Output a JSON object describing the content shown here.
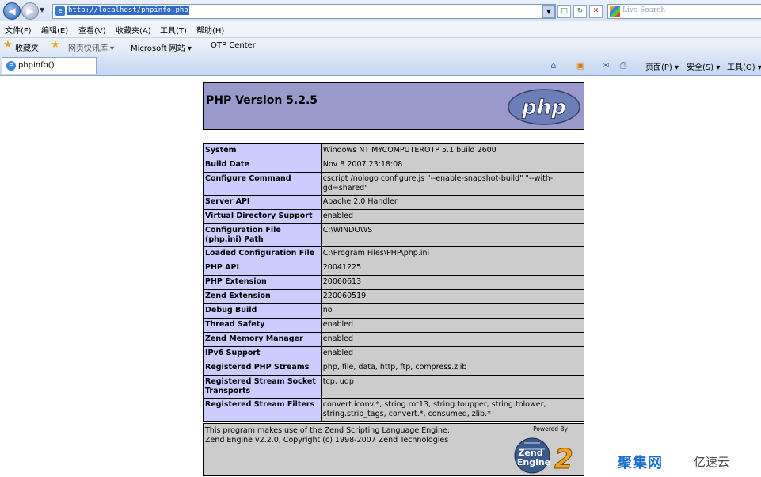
{
  "browser": {
    "address_url": "http://localhost/phpinfo.php",
    "search_placeholder": "Live Search",
    "menu": [
      "文件(F)",
      "编辑(E)",
      "查看(V)",
      "收藏夹(A)",
      "工具(T)",
      "帮助(H)"
    ],
    "favorites": {
      "label": "收藏夹",
      "items": [
        "网页快讯库 ▾",
        "Microsoft 网站 ▾",
        "OTP Center"
      ]
    },
    "tab": {
      "label": "phpinfo()"
    },
    "commands": {
      "page": "页面(P) ▾",
      "safety": "安全(S) ▾",
      "tools": "工具(O) ▾"
    }
  },
  "php": {
    "version_title": "PHP Version 5.2.5",
    "logo_text": "php",
    "rows": [
      {
        "k": "System",
        "v": "Windows NT MYCOMPUTEROTP 5.1 build 2600"
      },
      {
        "k": "Build Date",
        "v": "Nov 8 2007 23:18:08"
      },
      {
        "k": "Configure Command",
        "v": "cscript /nologo configure.js \"--enable-snapshot-build\" \"--with-gd=shared\""
      },
      {
        "k": "Server API",
        "v": "Apache 2.0 Handler"
      },
      {
        "k": "Virtual Directory Support",
        "v": "enabled"
      },
      {
        "k": "Configuration File (php.ini) Path",
        "v": "C:\\WINDOWS"
      },
      {
        "k": "Loaded Configuration File",
        "v": "C:\\Program Files\\PHP\\php.ini"
      },
      {
        "k": "PHP API",
        "v": "20041225"
      },
      {
        "k": "PHP Extension",
        "v": "20060613"
      },
      {
        "k": "Zend Extension",
        "v": "220060519"
      },
      {
        "k": "Debug Build",
        "v": "no"
      },
      {
        "k": "Thread Safety",
        "v": "enabled"
      },
      {
        "k": "Zend Memory Manager",
        "v": "enabled"
      },
      {
        "k": "IPv6 Support",
        "v": "enabled"
      },
      {
        "k": "Registered PHP Streams",
        "v": "php, file, data, http, ftp, compress.zlib"
      },
      {
        "k": "Registered Stream Socket Transports",
        "v": "tcp, udp"
      },
      {
        "k": "Registered Stream Filters",
        "v": "convert.iconv.*, string.rot13, string.toupper, string.tolower, string.strip_tags, convert.*, consumed, zlib.*"
      }
    ],
    "footer_line1": "This program makes use of the Zend Scripting Language Engine:",
    "footer_line2": "Zend Engine v2.2.0, Copyright (c) 1998-2007 Zend Technologies",
    "powered_by": "Powered By",
    "zend_logo_line1": "Zend",
    "zend_logo_line2": "Engine",
    "zend_logo_num": "2"
  },
  "watermark": {
    "brand": "聚集网",
    "sub": "亿速云"
  },
  "colors": {
    "header_bg": "#9999cc",
    "key_bg": "#ccccff",
    "value_bg": "#cccccc"
  }
}
